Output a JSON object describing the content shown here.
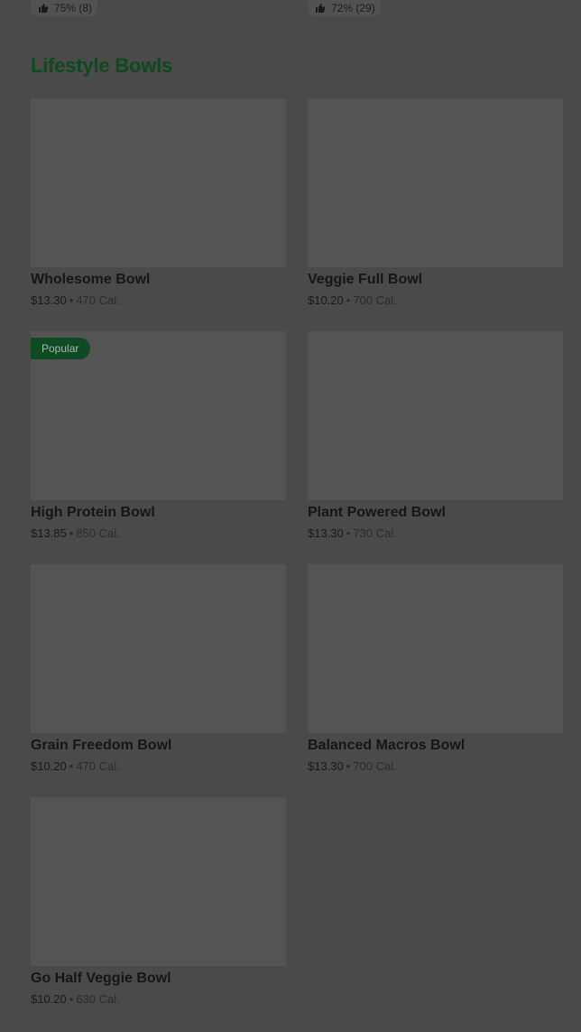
{
  "top_ratings": [
    {
      "icon": "thumbs-up-icon",
      "text": "75% (8)"
    },
    {
      "icon": "thumbs-up-icon",
      "text": "72% (29)"
    }
  ],
  "section": {
    "title": "Lifestyle Bowls"
  },
  "items": [
    {
      "name": "Wholesome Bowl",
      "price": "$13.30",
      "sep": "•",
      "calories": "470 Cal.",
      "badge": null
    },
    {
      "name": "Veggie Full Bowl",
      "price": "$10.20",
      "sep": "•",
      "calories": "700 Cal.",
      "badge": null
    },
    {
      "name": "High Protein Bowl",
      "price": "$13.85",
      "sep": "•",
      "calories": "850 Cal.",
      "badge": "Popular"
    },
    {
      "name": "Plant Powered Bowl",
      "price": "$13.30",
      "sep": "•",
      "calories": "730 Cal.",
      "badge": null
    },
    {
      "name": "Grain Freedom Bowl",
      "price": "$10.20",
      "sep": "•",
      "calories": "470 Cal.",
      "badge": null
    },
    {
      "name": "Balanced Macros Bowl",
      "price": "$13.30",
      "sep": "•",
      "calories": "700 Cal.",
      "badge": null
    },
    {
      "name": "Go Half Veggie Bowl",
      "price": "$10.20",
      "sep": "•",
      "calories": "630 Cal.",
      "badge": null
    }
  ],
  "colors": {
    "overlay": "#4a4a4a",
    "image_placeholder": "#545454",
    "badge_bg": "#0e4b25",
    "title": "#0d4b1f"
  }
}
